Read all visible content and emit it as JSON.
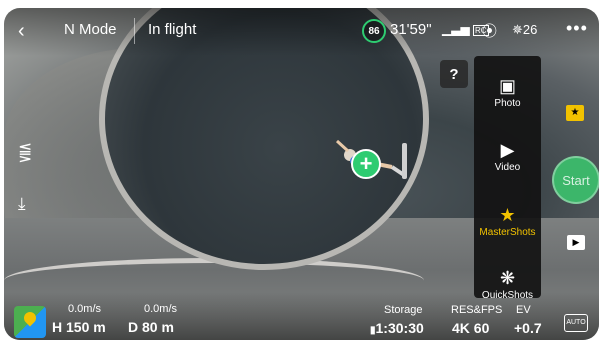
{
  "header": {
    "back_icon": "back-chevron-icon",
    "mode": "N Mode",
    "status": "In flight",
    "battery_percent": "86",
    "flight_time": "31'59\"",
    "signal_label": "RC",
    "obstacle_icon": "obstacle-sensing-icon",
    "satellite_count": "26",
    "more_icon": "more-dots-icon"
  },
  "help_label": "?",
  "shot_menu": {
    "items": [
      {
        "label": "Photo",
        "icon": "camera-icon"
      },
      {
        "label": "Video",
        "icon": "video-camera-icon"
      },
      {
        "label": "MasterShots",
        "icon": "mastershots-icon"
      },
      {
        "label": "QuickShots",
        "icon": "film-reel-icon"
      }
    ],
    "active": "MasterShots",
    "active_color": "#f2c200"
  },
  "start_label": "Start",
  "auto_label": "AUTO",
  "telemetry": {
    "h_speed": "0.0m/s",
    "v_speed": "0.0m/s",
    "height": "H 150 m",
    "distance": "D 80 m"
  },
  "camera_params": {
    "storage_label": "Storage",
    "storage_value": "1:30:30",
    "resfps_label": "RES&FPS",
    "resfps_value": "4K 60",
    "ev_label": "EV",
    "ev_value": "+0.7"
  },
  "colors": {
    "target_green": "#2ecc71",
    "start_green": "#3cb66a"
  }
}
